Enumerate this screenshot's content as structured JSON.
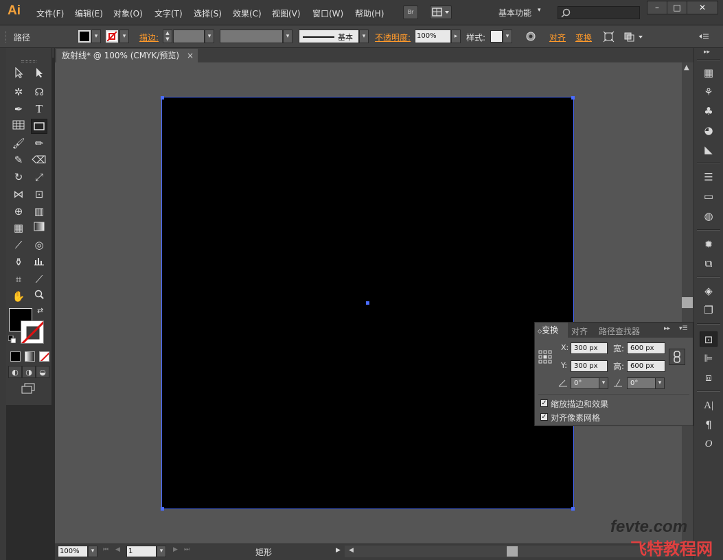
{
  "app": {
    "logo": "Ai"
  },
  "menubar": {
    "items": [
      "文件(F)",
      "编辑(E)",
      "对象(O)",
      "文字(T)",
      "选择(S)",
      "效果(C)",
      "视图(V)",
      "窗口(W)",
      "帮助(H)"
    ],
    "bridge_label": "Br",
    "workspace": "基本功能",
    "search_placeholder": "",
    "window_buttons": [
      "–",
      "□",
      "✕"
    ]
  },
  "control": {
    "selection_label": "路径",
    "stroke_label": "描边:",
    "stroke_profile": "基本",
    "opacity_label": "不透明度:",
    "opacity_value": "100%",
    "style_label": "样式:",
    "align_label": "对齐",
    "transform_label": "变换"
  },
  "document": {
    "tab_title": "放射线* @ 100% (CMYK/预览)",
    "tab_close": "×"
  },
  "status": {
    "zoom": "100%",
    "page": "1",
    "tool_name": "矩形"
  },
  "transform_panel": {
    "tabs": [
      "变换",
      "对齐",
      "路径查找器"
    ],
    "x_label": "X:",
    "x_value": "300 px",
    "y_label": "Y:",
    "y_value": "300 px",
    "w_label": "宽:",
    "w_value": "600 px",
    "h_label": "高:",
    "h_value": "600 px",
    "rotate_value": "0°",
    "shear_value": "0°",
    "scale_strokes_label": "缩放描边和效果",
    "align_pixel_label": "对齐像素网格",
    "scale_strokes_checked": true,
    "align_pixel_checked": true
  },
  "colors": {
    "accent_orange": "#ff9a2b",
    "selection_blue": "#4a6cff",
    "artboard_fill": "#000000",
    "canvas_bg": "#555555"
  },
  "watermark": {
    "line1": "fevte.com",
    "line2": "飞特教程网"
  }
}
